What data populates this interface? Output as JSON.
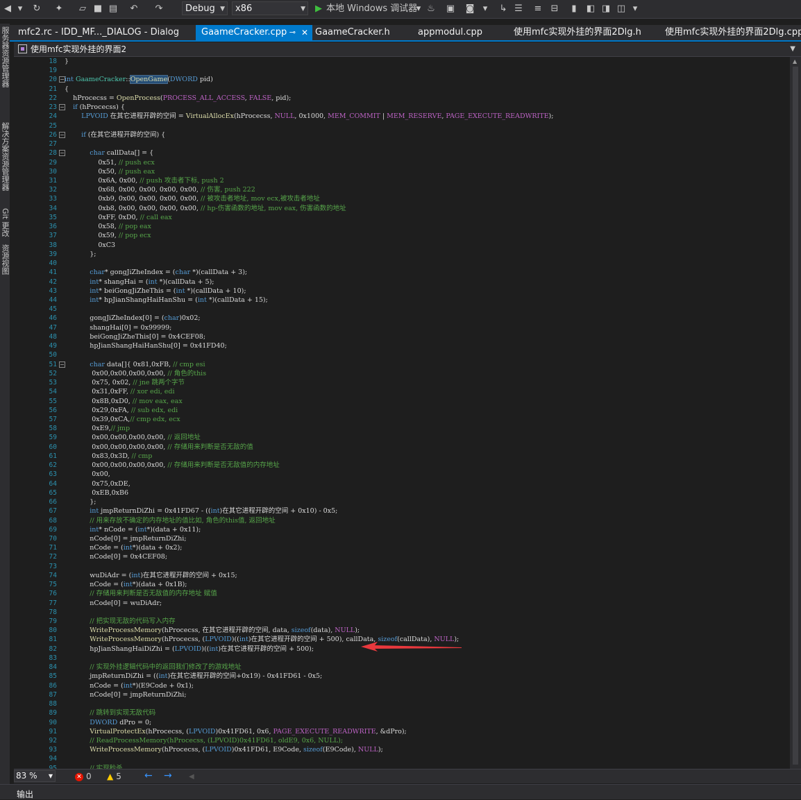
{
  "toolbar": {
    "config": "Debug",
    "platform": "x86",
    "run_label": "本地 Windows 调试器"
  },
  "tabs": [
    {
      "label": "mfc2.rc - IDD_MF..._DIALOG - Dialog",
      "active": false
    },
    {
      "label": "GaameCracker.cpp",
      "active": true
    },
    {
      "label": "GaameCracker.h",
      "active": false
    },
    {
      "label": "appmodul.cpp",
      "active": false
    },
    {
      "label": "使用mfc实现外挂的界面2Dlg.h",
      "active": false
    },
    {
      "label": "使用mfc实现外挂的界面2Dlg.cpp",
      "active": false
    }
  ],
  "navbar": {
    "title": "使用mfc实现外挂的界面2"
  },
  "side_panels": [
    "服务器资源管理器",
    "解决方案资源管理器",
    "Git 更改",
    "资源视图"
  ],
  "code_lines": [
    {
      "n": "18",
      "t": "}"
    },
    {
      "n": "19",
      "t": ""
    },
    {
      "n": "20",
      "t": "int GaameCracker::OpenGame(DWORD pid)",
      "fold": true
    },
    {
      "n": "21",
      "t": "{"
    },
    {
      "n": "22",
      "t": "    hProcecss = OpenProcess(PROCESS_ALL_ACCESS, FALSE, pid);"
    },
    {
      "n": "23",
      "t": "    if (hProcecss) {",
      "fold": true
    },
    {
      "n": "24",
      "t": "        LPVOID 在其它进程开辟的空间 = VirtualAllocEx(hProcecss, NULL, 0x1000, MEM_COMMIT | MEM_RESERVE, PAGE_EXECUTE_READWRITE);"
    },
    {
      "n": "25",
      "t": ""
    },
    {
      "n": "26",
      "t": "        if (在其它进程开辟的空间) {",
      "fold": true
    },
    {
      "n": "27",
      "t": ""
    },
    {
      "n": "28",
      "t": "            char callData[] = {",
      "fold": true
    },
    {
      "n": "29",
      "t": "                0x51, // push ecx"
    },
    {
      "n": "30",
      "t": "                0x50, // push eax"
    },
    {
      "n": "31",
      "t": "                0x6A, 0x00, // push 攻击者下标, push 2"
    },
    {
      "n": "32",
      "t": "                0x68, 0x00, 0x00, 0x00, 0x00, // 伤害, push 222"
    },
    {
      "n": "33",
      "t": "                0xb9, 0x00, 0x00, 0x00, 0x00, // 被攻击者地址, mov ecx,被攻击者地址"
    },
    {
      "n": "34",
      "t": "                0xb8, 0x00, 0x00, 0x00, 0x00, // hp-伤害函数的地址, mov eax, 伤害函数的地址"
    },
    {
      "n": "35",
      "t": "                0xFF, 0xD0, // call eax"
    },
    {
      "n": "36",
      "t": "                0x58, // pop eax"
    },
    {
      "n": "37",
      "t": "                0x59, // pop ecx"
    },
    {
      "n": "38",
      "t": "                0xC3"
    },
    {
      "n": "39",
      "t": "            };"
    },
    {
      "n": "40",
      "t": ""
    },
    {
      "n": "41",
      "t": "            char* gongJiZheIndex = (char *)(callData + 3);"
    },
    {
      "n": "42",
      "t": "            int* shangHai = (int *)(callData + 5);"
    },
    {
      "n": "43",
      "t": "            int* beiGongJiZheThis = (int *)(callData + 10);"
    },
    {
      "n": "44",
      "t": "            int* hpJianShangHaiHanShu = (int *)(callData + 15);"
    },
    {
      "n": "45",
      "t": ""
    },
    {
      "n": "46",
      "t": "            gongJiZheIndex[0] = (char)0x02;"
    },
    {
      "n": "47",
      "t": "            shangHai[0] = 0x99999;"
    },
    {
      "n": "48",
      "t": "            beiGongJiZheThis[0] = 0x4CEF08;"
    },
    {
      "n": "49",
      "t": "            hpJianShangHaiHanShu[0] = 0x41FD40;"
    },
    {
      "n": "50",
      "t": ""
    },
    {
      "n": "51",
      "t": "            char data[]{ 0x81,0xFB, // cmp esi",
      "fold": true
    },
    {
      "n": "52",
      "t": "             0x00,0x00,0x00,0x00, // 角色的this"
    },
    {
      "n": "53",
      "t": "             0x75, 0x02, // jne 跳两个字节"
    },
    {
      "n": "54",
      "t": "             0x31,0xFF, // xor edi, edi"
    },
    {
      "n": "55",
      "t": "             0x8B,0xD0, // mov eax, eax"
    },
    {
      "n": "56",
      "t": "             0x29,0xFA, // sub edx, edi"
    },
    {
      "n": "57",
      "t": "             0x39,0xCA,// cmp edx, ecx"
    },
    {
      "n": "58",
      "t": "             0xE9,// jmp"
    },
    {
      "n": "59",
      "t": "             0x00,0x00,0x00,0x00, // 返回地址"
    },
    {
      "n": "60",
      "t": "             0x00,0x00,0x00,0x00, // 存储用来判断是否无敌的值"
    },
    {
      "n": "61",
      "t": "             0x83,0x3D, // cmp"
    },
    {
      "n": "62",
      "t": "             0x00,0x00,0x00,0x00, // 存储用来判断是否无敌值的内存地址"
    },
    {
      "n": "63",
      "t": "             0x00,"
    },
    {
      "n": "64",
      "t": "             0x75,0xDE,"
    },
    {
      "n": "65",
      "t": "             0xEB,0xB6"
    },
    {
      "n": "66",
      "t": "            };"
    },
    {
      "n": "67",
      "t": "            int jmpReturnDiZhi = 0x41FD67 - ((int)在其它进程开辟的空间 + 0x10) - 0x5;"
    },
    {
      "n": "68",
      "t": "            // 用来存放不确定的内存地址的值比如, 角色的this值, 返回地址"
    },
    {
      "n": "69",
      "t": "            int* nCode = (int*)(data + 0x11);"
    },
    {
      "n": "70",
      "t": "            nCode[0] = jmpReturnDiZhi;"
    },
    {
      "n": "71",
      "t": "            nCode = (int*)(data + 0x2);"
    },
    {
      "n": "72",
      "t": "            nCode[0] = 0x4CEF08;"
    },
    {
      "n": "73",
      "t": ""
    },
    {
      "n": "74",
      "t": "            wuDiAdr = (int)在其它进程开辟的空间 + 0x15;"
    },
    {
      "n": "75",
      "t": "            nCode = (int*)(data + 0x1B);"
    },
    {
      "n": "76",
      "t": "            // 存储用来判断是否无敌值的内存地址 赋值"
    },
    {
      "n": "77",
      "t": "            nCode[0] = wuDiAdr;"
    },
    {
      "n": "78",
      "t": ""
    },
    {
      "n": "79",
      "t": "            // 把实现无敌的代码写入内存"
    },
    {
      "n": "80",
      "t": "            WriteProcessMemory(hProcecss, 在其它进程开辟的空间, data, sizeof(data), NULL);"
    },
    {
      "n": "81",
      "t": "            WriteProcessMemory(hProcecss, (LPVOID)((int)在其它进程开辟的空间 + 500), callData, sizeof(callData), NULL);"
    },
    {
      "n": "82",
      "t": "            hpJianShangHaiDiZhi = (LPVOID)((int)在其它进程开辟的空间 + 500);"
    },
    {
      "n": "83",
      "t": ""
    },
    {
      "n": "84",
      "t": "            // 实现外挂逻辑代码中的返回我们修改了的游戏地址"
    },
    {
      "n": "85",
      "t": "            jmpReturnDiZhi = ((int)在其它进程开辟的空间+0x19) - 0x41FD61 - 0x5;"
    },
    {
      "n": "86",
      "t": "            nCode = (int*)(E9Code + 0x1);"
    },
    {
      "n": "87",
      "t": "            nCode[0] = jmpReturnDiZhi;"
    },
    {
      "n": "88",
      "t": ""
    },
    {
      "n": "89",
      "t": "            // 跳转到实现无敌代码"
    },
    {
      "n": "90",
      "t": "            DWORD dPro = 0;"
    },
    {
      "n": "91",
      "t": "            VirtualProtectEx(hProcecss, (LPVOID)0x41FD61, 0x6, PAGE_EXECUTE_READWRITE, &dPro);"
    },
    {
      "n": "92",
      "t": "            // ReadProcessMemory(hProcecss, (LPVOID)0x41FD61, oldE9, 0x6, NULL);"
    },
    {
      "n": "93",
      "t": "            WriteProcessMemory(hProcecss, (LPVOID)0x41FD61, E9Code, sizeof(E9Code), NULL);"
    },
    {
      "n": "94",
      "t": ""
    },
    {
      "n": "95",
      "t": "            // 实现秒杀"
    }
  ],
  "status": {
    "zoom": "83 %",
    "errors": "0",
    "warnings": "5"
  },
  "output": {
    "label": "输出"
  },
  "colors": {
    "accent": "#007acc",
    "arrow": "#e8383d"
  }
}
